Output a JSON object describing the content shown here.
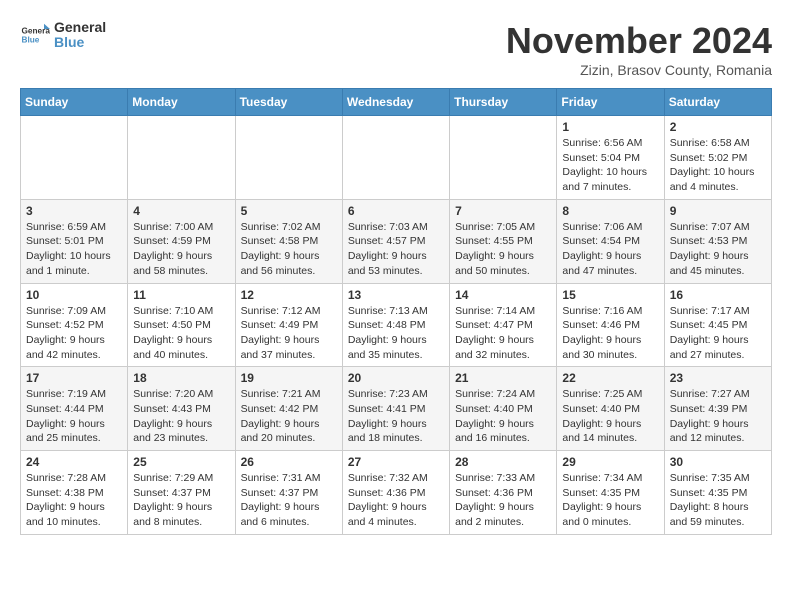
{
  "header": {
    "logo_general": "General",
    "logo_blue": "Blue",
    "title": "November 2024",
    "subtitle": "Zizin, Brasov County, Romania"
  },
  "weekdays": [
    "Sunday",
    "Monday",
    "Tuesday",
    "Wednesday",
    "Thursday",
    "Friday",
    "Saturday"
  ],
  "weeks": [
    [
      {
        "day": "",
        "info": ""
      },
      {
        "day": "",
        "info": ""
      },
      {
        "day": "",
        "info": ""
      },
      {
        "day": "",
        "info": ""
      },
      {
        "day": "",
        "info": ""
      },
      {
        "day": "1",
        "info": "Sunrise: 6:56 AM\nSunset: 5:04 PM\nDaylight: 10 hours and 7 minutes."
      },
      {
        "day": "2",
        "info": "Sunrise: 6:58 AM\nSunset: 5:02 PM\nDaylight: 10 hours and 4 minutes."
      }
    ],
    [
      {
        "day": "3",
        "info": "Sunrise: 6:59 AM\nSunset: 5:01 PM\nDaylight: 10 hours and 1 minute."
      },
      {
        "day": "4",
        "info": "Sunrise: 7:00 AM\nSunset: 4:59 PM\nDaylight: 9 hours and 58 minutes."
      },
      {
        "day": "5",
        "info": "Sunrise: 7:02 AM\nSunset: 4:58 PM\nDaylight: 9 hours and 56 minutes."
      },
      {
        "day": "6",
        "info": "Sunrise: 7:03 AM\nSunset: 4:57 PM\nDaylight: 9 hours and 53 minutes."
      },
      {
        "day": "7",
        "info": "Sunrise: 7:05 AM\nSunset: 4:55 PM\nDaylight: 9 hours and 50 minutes."
      },
      {
        "day": "8",
        "info": "Sunrise: 7:06 AM\nSunset: 4:54 PM\nDaylight: 9 hours and 47 minutes."
      },
      {
        "day": "9",
        "info": "Sunrise: 7:07 AM\nSunset: 4:53 PM\nDaylight: 9 hours and 45 minutes."
      }
    ],
    [
      {
        "day": "10",
        "info": "Sunrise: 7:09 AM\nSunset: 4:52 PM\nDaylight: 9 hours and 42 minutes."
      },
      {
        "day": "11",
        "info": "Sunrise: 7:10 AM\nSunset: 4:50 PM\nDaylight: 9 hours and 40 minutes."
      },
      {
        "day": "12",
        "info": "Sunrise: 7:12 AM\nSunset: 4:49 PM\nDaylight: 9 hours and 37 minutes."
      },
      {
        "day": "13",
        "info": "Sunrise: 7:13 AM\nSunset: 4:48 PM\nDaylight: 9 hours and 35 minutes."
      },
      {
        "day": "14",
        "info": "Sunrise: 7:14 AM\nSunset: 4:47 PM\nDaylight: 9 hours and 32 minutes."
      },
      {
        "day": "15",
        "info": "Sunrise: 7:16 AM\nSunset: 4:46 PM\nDaylight: 9 hours and 30 minutes."
      },
      {
        "day": "16",
        "info": "Sunrise: 7:17 AM\nSunset: 4:45 PM\nDaylight: 9 hours and 27 minutes."
      }
    ],
    [
      {
        "day": "17",
        "info": "Sunrise: 7:19 AM\nSunset: 4:44 PM\nDaylight: 9 hours and 25 minutes."
      },
      {
        "day": "18",
        "info": "Sunrise: 7:20 AM\nSunset: 4:43 PM\nDaylight: 9 hours and 23 minutes."
      },
      {
        "day": "19",
        "info": "Sunrise: 7:21 AM\nSunset: 4:42 PM\nDaylight: 9 hours and 20 minutes."
      },
      {
        "day": "20",
        "info": "Sunrise: 7:23 AM\nSunset: 4:41 PM\nDaylight: 9 hours and 18 minutes."
      },
      {
        "day": "21",
        "info": "Sunrise: 7:24 AM\nSunset: 4:40 PM\nDaylight: 9 hours and 16 minutes."
      },
      {
        "day": "22",
        "info": "Sunrise: 7:25 AM\nSunset: 4:40 PM\nDaylight: 9 hours and 14 minutes."
      },
      {
        "day": "23",
        "info": "Sunrise: 7:27 AM\nSunset: 4:39 PM\nDaylight: 9 hours and 12 minutes."
      }
    ],
    [
      {
        "day": "24",
        "info": "Sunrise: 7:28 AM\nSunset: 4:38 PM\nDaylight: 9 hours and 10 minutes."
      },
      {
        "day": "25",
        "info": "Sunrise: 7:29 AM\nSunset: 4:37 PM\nDaylight: 9 hours and 8 minutes."
      },
      {
        "day": "26",
        "info": "Sunrise: 7:31 AM\nSunset: 4:37 PM\nDaylight: 9 hours and 6 minutes."
      },
      {
        "day": "27",
        "info": "Sunrise: 7:32 AM\nSunset: 4:36 PM\nDaylight: 9 hours and 4 minutes."
      },
      {
        "day": "28",
        "info": "Sunrise: 7:33 AM\nSunset: 4:36 PM\nDaylight: 9 hours and 2 minutes."
      },
      {
        "day": "29",
        "info": "Sunrise: 7:34 AM\nSunset: 4:35 PM\nDaylight: 9 hours and 0 minutes."
      },
      {
        "day": "30",
        "info": "Sunrise: 7:35 AM\nSunset: 4:35 PM\nDaylight: 8 hours and 59 minutes."
      }
    ]
  ]
}
